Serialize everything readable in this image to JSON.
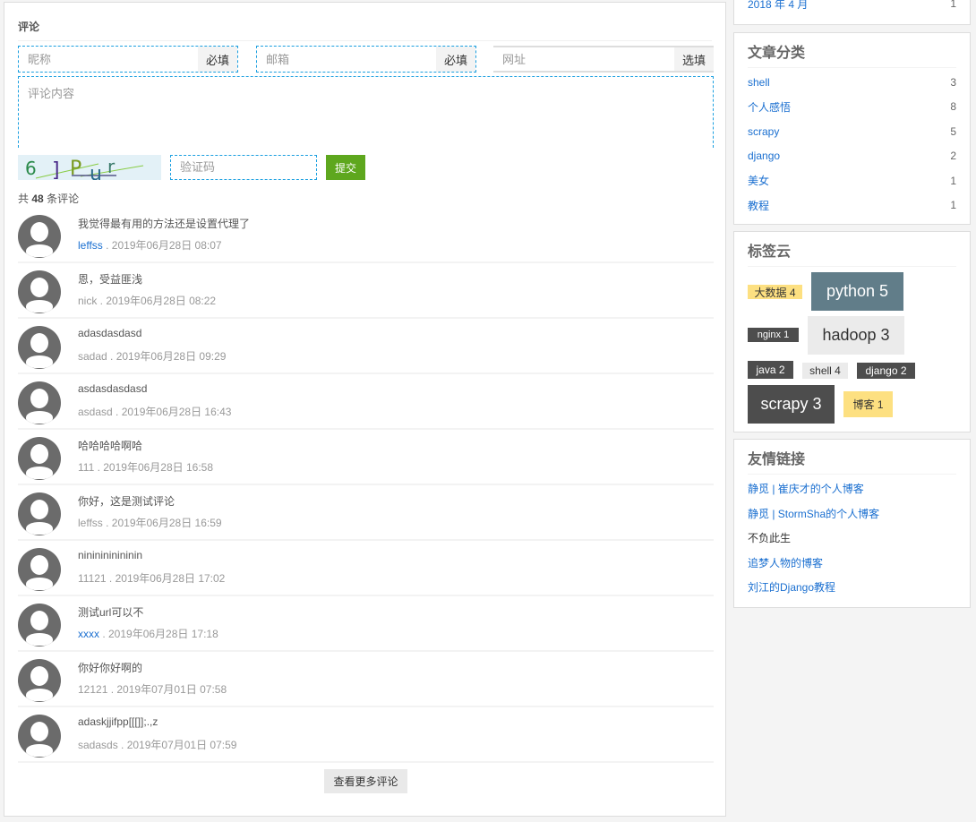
{
  "comment_form": {
    "title": "评论",
    "nickname_placeholder": "昵称",
    "nickname_tag": "必填",
    "email_placeholder": "邮箱",
    "email_tag": "必填",
    "url_placeholder": "网址",
    "url_tag": "选填",
    "content_placeholder": "评论内容",
    "captcha_text": "6 ] P u r",
    "code_placeholder": "验证码",
    "submit_label": "提交"
  },
  "comments_count": {
    "prefix": "共",
    "count": "48",
    "suffix": "条评论"
  },
  "comments": [
    {
      "text": "我觉得最有用的方法还是设置代理了",
      "user": "leffss",
      "time": " . 2019年06月28日 08:07",
      "link": true
    },
    {
      "text": "恩，受益匪浅",
      "user": "nick",
      "time": " . 2019年06月28日 08:22",
      "link": false
    },
    {
      "text": "adasdasdasd",
      "user": "sadad",
      "time": " . 2019年06月28日 09:29",
      "link": false
    },
    {
      "text": "asdasdasdasd",
      "user": "asdasd",
      "time": " . 2019年06月28日 16:43",
      "link": false
    },
    {
      "text": "哈哈哈哈啊哈",
      "user": "111",
      "time": " . 2019年06月28日 16:58",
      "link": false
    },
    {
      "text": "你好，这是测试评论",
      "user": "leffss",
      "time": " . 2019年06月28日 16:59",
      "link": false
    },
    {
      "text": "nininininininin",
      "user": "11121",
      "time": " . 2019年06月28日 17:02",
      "link": false
    },
    {
      "text": "测试url可以不",
      "user": "xxxx",
      "time": " . 2019年06月28日 17:18",
      "link": true
    },
    {
      "text": "你好你好啊的",
      "user": "12121",
      "time": " . 2019年07月01日 07:58",
      "link": false
    },
    {
      "text": "adaskjjifpp[[[]];.,z",
      "user": "sadasds",
      "time": " . 2019年07月01日 07:59",
      "link": false
    }
  ],
  "more_label": "查看更多评论",
  "archive": {
    "item": {
      "label": "2018 年 4 月",
      "count": "1"
    }
  },
  "categories": {
    "title": "文章分类",
    "items": [
      {
        "label": "shell",
        "count": "3"
      },
      {
        "label": "个人感悟",
        "count": "8"
      },
      {
        "label": "scrapy",
        "count": "5"
      },
      {
        "label": "django",
        "count": "2"
      },
      {
        "label": "美女",
        "count": "1"
      },
      {
        "label": "教程",
        "count": "1"
      }
    ]
  },
  "tag_cloud": {
    "title": "标签云",
    "tags": [
      {
        "label": "大数据 4"
      },
      {
        "label": "python 5"
      },
      {
        "label": "nginx 1"
      },
      {
        "label": "hadoop 3"
      },
      {
        "label": "java 2"
      },
      {
        "label": "shell 4"
      },
      {
        "label": "django 2"
      },
      {
        "label": "scrapy 3"
      },
      {
        "label": "博客 1"
      }
    ]
  },
  "links": {
    "title": "友情链接",
    "items": [
      {
        "label": "静觅 | 崔庆才的个人博客"
      },
      {
        "label": "静觅 | StormSha的个人博客"
      },
      {
        "label": "不负此生"
      },
      {
        "label": "追梦人物的博客"
      },
      {
        "label": "刘江的Django教程"
      }
    ]
  },
  "colors": {
    "accent": "#1a9fe0",
    "submit": "#5ea71e",
    "link": "#1a6fd0"
  }
}
